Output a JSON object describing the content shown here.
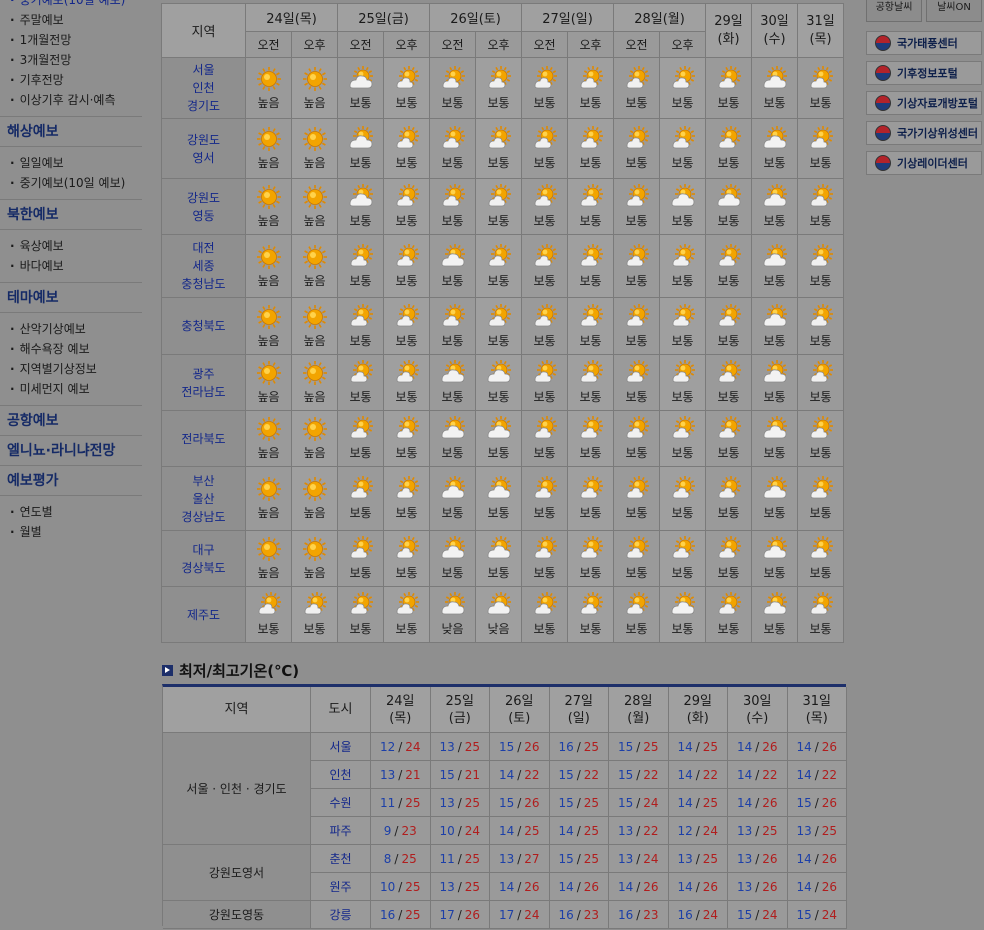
{
  "sidebar": {
    "top_cut": "중기예보(10일 예보)",
    "groups": [
      {
        "title": "",
        "items": [
          "주말예보",
          "1개월전망",
          "3개월전망",
          "기후전망",
          "이상기후 감시·예측"
        ]
      },
      {
        "title": "해상예보",
        "items": [
          "일일예보",
          "중기예보(10일 예보)"
        ]
      },
      {
        "title": "북한예보",
        "items": [
          "육상예보",
          "바다예보"
        ]
      },
      {
        "title": "테마예보",
        "items": [
          "산악기상예보",
          "해수욕장 예보",
          "지역별기상정보",
          "미세먼지 예보"
        ]
      },
      {
        "title": "공항예보",
        "items": []
      },
      {
        "title": "엘니뇨·라니냐전망",
        "items": []
      },
      {
        "title": "예보평가",
        "items": [
          "연도별",
          "월별"
        ]
      }
    ]
  },
  "right_panel": {
    "top_buttons": [
      "공항날씨",
      "날씨ON"
    ],
    "links": [
      "국가태풍센터",
      "기후정보포털",
      "기상자료개방포털",
      "국가기상위성센터",
      "기상레이더센터"
    ]
  },
  "forecast": {
    "region_header": "지역",
    "days_ampm": [
      {
        "label": "24일(목)",
        "am": "오전",
        "pm": "오후"
      },
      {
        "label": "25일(금)",
        "am": "오전",
        "pm": "오후"
      },
      {
        "label": "26일(토)",
        "am": "오전",
        "pm": "오후"
      },
      {
        "label": "27일(일)",
        "am": "오전",
        "pm": "오후"
      },
      {
        "label": "28일(월)",
        "am": "오전",
        "pm": "오후"
      }
    ],
    "days_single": [
      {
        "label1": "29일",
        "label2": "(화)"
      },
      {
        "label1": "30일",
        "label2": "(수)"
      },
      {
        "label1": "31일",
        "label2": "(목)"
      }
    ],
    "rows": [
      {
        "region": [
          "서울",
          "인천",
          "경기도"
        ],
        "h": 61,
        "cells": [
          [
            "sunny",
            "높음"
          ],
          [
            "sunny",
            "높음"
          ],
          [
            "cloud",
            "보통"
          ],
          [
            "partly",
            "보통"
          ],
          [
            "partly",
            "보통"
          ],
          [
            "partly",
            "보통"
          ],
          [
            "partly",
            "보통"
          ],
          [
            "partly",
            "보통"
          ],
          [
            "partly",
            "보통"
          ],
          [
            "partly",
            "보통"
          ],
          [
            "partly",
            "보통"
          ],
          [
            "cloud",
            "보통"
          ],
          [
            "partly",
            "보통"
          ]
        ]
      },
      {
        "region": [
          "강원도",
          "영서"
        ],
        "h": 60,
        "cells": [
          [
            "sunny",
            "높음"
          ],
          [
            "sunny",
            "높음"
          ],
          [
            "cloud",
            "보통"
          ],
          [
            "partly",
            "보통"
          ],
          [
            "partly",
            "보통"
          ],
          [
            "partly",
            "보통"
          ],
          [
            "partly",
            "보통"
          ],
          [
            "partly",
            "보통"
          ],
          [
            "partly",
            "보통"
          ],
          [
            "partly",
            "보통"
          ],
          [
            "partly",
            "보통"
          ],
          [
            "cloud",
            "보통"
          ],
          [
            "partly",
            "보통"
          ]
        ]
      },
      {
        "region": [
          "강원도",
          "영동"
        ],
        "h": 56,
        "cells": [
          [
            "sunny",
            "높음"
          ],
          [
            "sunny",
            "높음"
          ],
          [
            "cloud",
            "보통"
          ],
          [
            "partly",
            "보통"
          ],
          [
            "partly",
            "보통"
          ],
          [
            "partly",
            "보통"
          ],
          [
            "partly",
            "보통"
          ],
          [
            "partly",
            "보통"
          ],
          [
            "partly",
            "보통"
          ],
          [
            "cloud",
            "보통"
          ],
          [
            "cloud",
            "보통"
          ],
          [
            "cloud",
            "보통"
          ],
          [
            "partly",
            "보통"
          ]
        ]
      },
      {
        "region": [
          "대전",
          "세종",
          "충청남도"
        ],
        "h": 63,
        "cells": [
          [
            "sunny",
            "높음"
          ],
          [
            "sunny",
            "높음"
          ],
          [
            "partly",
            "보통"
          ],
          [
            "partly",
            "보통"
          ],
          [
            "cloud",
            "보통"
          ],
          [
            "partly",
            "보통"
          ],
          [
            "partly",
            "보통"
          ],
          [
            "partly",
            "보통"
          ],
          [
            "partly",
            "보통"
          ],
          [
            "partly",
            "보통"
          ],
          [
            "partly",
            "보통"
          ],
          [
            "cloud",
            "보통"
          ],
          [
            "partly",
            "보통"
          ]
        ]
      },
      {
        "region": [
          "충청북도"
        ],
        "h": 57,
        "cells": [
          [
            "sunny",
            "높음"
          ],
          [
            "sunny",
            "높음"
          ],
          [
            "partly",
            "보통"
          ],
          [
            "partly",
            "보통"
          ],
          [
            "partly",
            "보통"
          ],
          [
            "partly",
            "보통"
          ],
          [
            "partly",
            "보통"
          ],
          [
            "partly",
            "보통"
          ],
          [
            "partly",
            "보통"
          ],
          [
            "partly",
            "보통"
          ],
          [
            "partly",
            "보통"
          ],
          [
            "cloud",
            "보통"
          ],
          [
            "partly",
            "보통"
          ]
        ]
      },
      {
        "region": [
          "광주",
          "전라남도"
        ],
        "h": 56,
        "cells": [
          [
            "sunny",
            "높음"
          ],
          [
            "sunny",
            "높음"
          ],
          [
            "partly",
            "보통"
          ],
          [
            "partly",
            "보통"
          ],
          [
            "cloud",
            "보통"
          ],
          [
            "cloud",
            "보통"
          ],
          [
            "partly",
            "보통"
          ],
          [
            "partly",
            "보통"
          ],
          [
            "partly",
            "보통"
          ],
          [
            "partly",
            "보통"
          ],
          [
            "partly",
            "보통"
          ],
          [
            "cloud",
            "보통"
          ],
          [
            "partly",
            "보통"
          ]
        ]
      },
      {
        "region": [
          "전라북도"
        ],
        "h": 56,
        "cells": [
          [
            "sunny",
            "높음"
          ],
          [
            "sunny",
            "높음"
          ],
          [
            "partly",
            "보통"
          ],
          [
            "partly",
            "보통"
          ],
          [
            "cloud",
            "보통"
          ],
          [
            "cloud",
            "보통"
          ],
          [
            "partly",
            "보통"
          ],
          [
            "partly",
            "보통"
          ],
          [
            "partly",
            "보통"
          ],
          [
            "partly",
            "보통"
          ],
          [
            "partly",
            "보통"
          ],
          [
            "cloud",
            "보통"
          ],
          [
            "partly",
            "보통"
          ]
        ]
      },
      {
        "region": [
          "부산",
          "울산",
          "경상남도"
        ],
        "h": 64,
        "cells": [
          [
            "sunny",
            "높음"
          ],
          [
            "sunny",
            "높음"
          ],
          [
            "partly",
            "보통"
          ],
          [
            "partly",
            "보통"
          ],
          [
            "cloud",
            "보통"
          ],
          [
            "cloud",
            "보통"
          ],
          [
            "partly",
            "보통"
          ],
          [
            "partly",
            "보통"
          ],
          [
            "partly",
            "보통"
          ],
          [
            "partly",
            "보통"
          ],
          [
            "partly",
            "보통"
          ],
          [
            "cloud",
            "보통"
          ],
          [
            "partly",
            "보통"
          ]
        ]
      },
      {
        "region": [
          "대구",
          "경상북도"
        ],
        "h": 56,
        "cells": [
          [
            "sunny",
            "높음"
          ],
          [
            "sunny",
            "높음"
          ],
          [
            "partly",
            "보통"
          ],
          [
            "partly",
            "보통"
          ],
          [
            "cloud",
            "보통"
          ],
          [
            "cloud",
            "보통"
          ],
          [
            "partly",
            "보통"
          ],
          [
            "partly",
            "보통"
          ],
          [
            "partly",
            "보통"
          ],
          [
            "partly",
            "보통"
          ],
          [
            "partly",
            "보통"
          ],
          [
            "cloud",
            "보통"
          ],
          [
            "partly",
            "보통"
          ]
        ]
      },
      {
        "region": [
          "제주도"
        ],
        "h": 56,
        "cells": [
          [
            "partly",
            "보통"
          ],
          [
            "partly",
            "보통"
          ],
          [
            "partly",
            "보통"
          ],
          [
            "partly",
            "보통"
          ],
          [
            "cloud",
            "낮음"
          ],
          [
            "cloud",
            "낮음"
          ],
          [
            "partly",
            "보통"
          ],
          [
            "partly",
            "보통"
          ],
          [
            "partly",
            "보통"
          ],
          [
            "cloud",
            "보통"
          ],
          [
            "partly",
            "보통"
          ],
          [
            "cloud",
            "보통"
          ],
          [
            "partly",
            "보통"
          ]
        ]
      }
    ]
  },
  "temperature": {
    "title": "최저/최고기온(℃)",
    "headers": {
      "region": "지역",
      "city": "도시"
    },
    "days": [
      {
        "d": "24일",
        "w": "(목)"
      },
      {
        "d": "25일",
        "w": "(금)"
      },
      {
        "d": "26일",
        "w": "(토)"
      },
      {
        "d": "27일",
        "w": "(일)"
      },
      {
        "d": "28일",
        "w": "(월)"
      },
      {
        "d": "29일",
        "w": "(화)"
      },
      {
        "d": "30일",
        "w": "(수)"
      },
      {
        "d": "31일",
        "w": "(목)"
      }
    ],
    "groups": [
      {
        "region": "서울 · 인천 · 경기도",
        "cities": [
          {
            "name": "서울",
            "vals": [
              [
                12,
                24
              ],
              [
                13,
                25
              ],
              [
                15,
                26
              ],
              [
                16,
                25
              ],
              [
                15,
                25
              ],
              [
                14,
                25
              ],
              [
                14,
                26
              ],
              [
                14,
                26
              ]
            ]
          },
          {
            "name": "인천",
            "vals": [
              [
                13,
                21
              ],
              [
                15,
                21
              ],
              [
                14,
                22
              ],
              [
                15,
                22
              ],
              [
                15,
                22
              ],
              [
                14,
                22
              ],
              [
                14,
                22
              ],
              [
                14,
                22
              ]
            ]
          },
          {
            "name": "수원",
            "vals": [
              [
                11,
                25
              ],
              [
                13,
                25
              ],
              [
                15,
                26
              ],
              [
                15,
                25
              ],
              [
                15,
                24
              ],
              [
                14,
                25
              ],
              [
                14,
                26
              ],
              [
                15,
                26
              ]
            ]
          },
          {
            "name": "파주",
            "vals": [
              [
                9,
                23
              ],
              [
                10,
                24
              ],
              [
                14,
                25
              ],
              [
                14,
                25
              ],
              [
                13,
                22
              ],
              [
                12,
                24
              ],
              [
                13,
                25
              ],
              [
                13,
                25
              ]
            ]
          }
        ]
      },
      {
        "region": "강원도영서",
        "cities": [
          {
            "name": "춘천",
            "vals": [
              [
                8,
                25
              ],
              [
                11,
                25
              ],
              [
                13,
                27
              ],
              [
                15,
                25
              ],
              [
                13,
                24
              ],
              [
                13,
                25
              ],
              [
                13,
                26
              ],
              [
                14,
                26
              ]
            ]
          },
          {
            "name": "원주",
            "vals": [
              [
                10,
                25
              ],
              [
                13,
                25
              ],
              [
                14,
                26
              ],
              [
                14,
                26
              ],
              [
                14,
                26
              ],
              [
                14,
                26
              ],
              [
                13,
                26
              ],
              [
                14,
                26
              ]
            ]
          }
        ]
      },
      {
        "region": "강원도영동",
        "cities": [
          {
            "name": "강릉",
            "vals": [
              [
                16,
                25
              ],
              [
                17,
                26
              ],
              [
                17,
                24
              ],
              [
                16,
                23
              ],
              [
                16,
                23
              ],
              [
                16,
                24
              ],
              [
                15,
                24
              ],
              [
                15,
                24
              ]
            ]
          }
        ]
      }
    ]
  },
  "colors": {
    "low": "#1c3fa8",
    "high": "#b01e1e",
    "region_text": "#13278a",
    "nav_title": "#152a66"
  }
}
